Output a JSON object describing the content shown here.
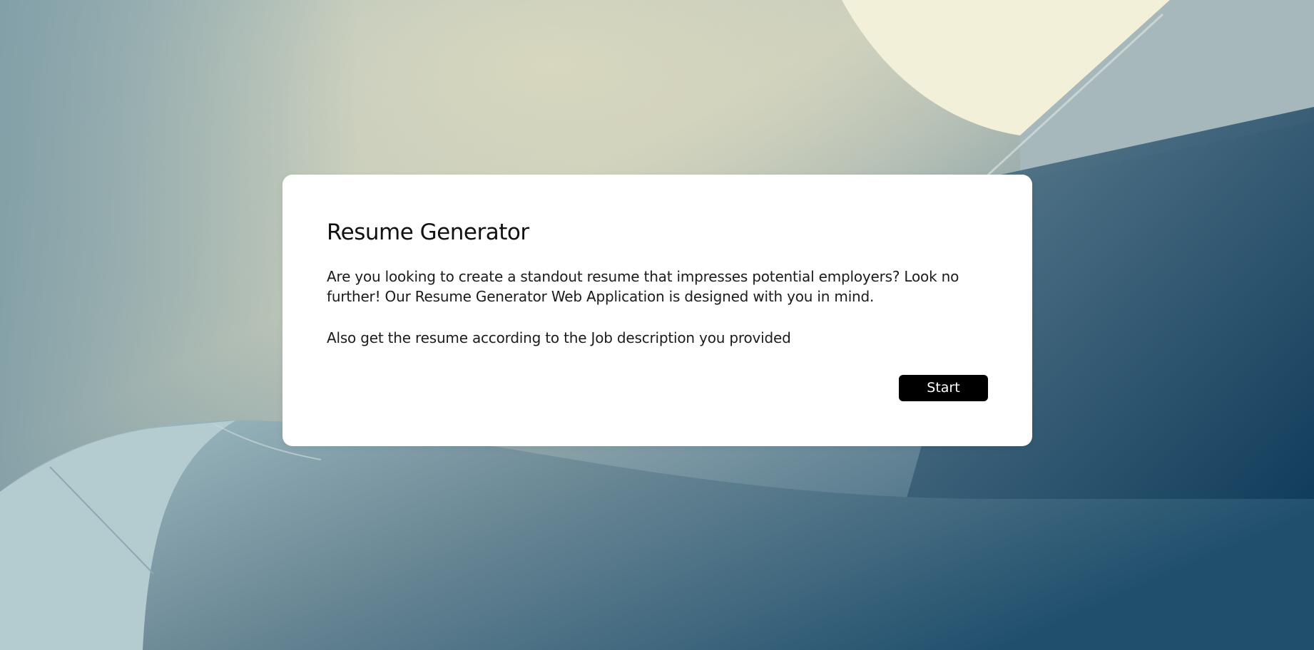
{
  "page": {
    "background_colors": {
      "sage": "#c9d0bf",
      "pale_yellow": "#f3f1dc",
      "slate": "#8aa3ab",
      "steel": "#6d8c99",
      "deep_navy": "#073a5c"
    }
  },
  "card": {
    "title": "Resume Generator",
    "description": "Are you looking to create a standout resume that impresses potential employers? Look no further! Our Resume Generator Web Application is designed with you in mind.",
    "subtext": "Also get the resume according to the Job description you provided",
    "start_label": "Start",
    "button_color": "#000000"
  }
}
